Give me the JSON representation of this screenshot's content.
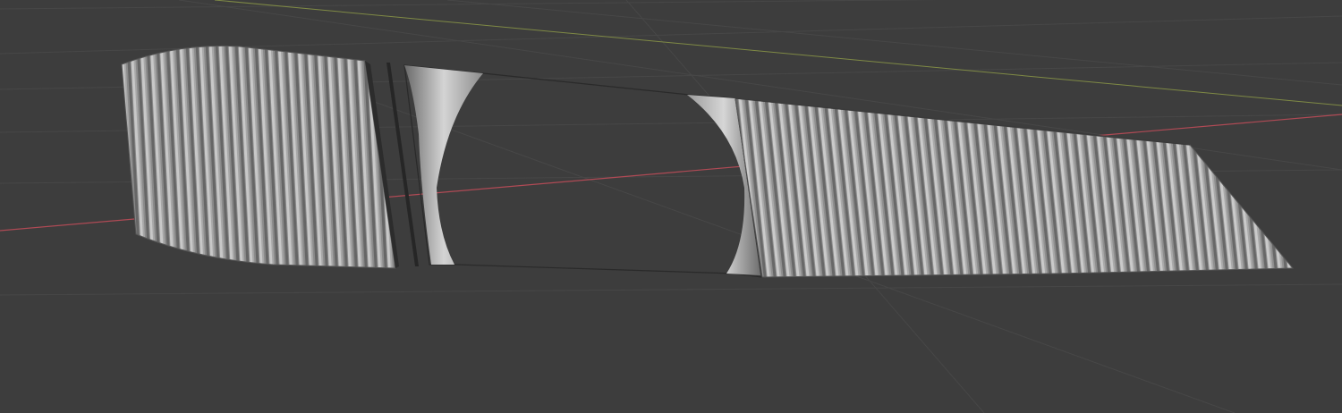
{
  "viewport": {
    "background": "#3d3d3d",
    "grid_color": "#474747",
    "x_axis_color": "#b04a55",
    "y_axis_color": "#7f8a45",
    "mesh_color": "#a9a9a9",
    "mesh_edge_color": "#2b2b2b"
  },
  "objects": [
    {
      "name": "left-panel",
      "kind": "corrugated-mesh"
    },
    {
      "name": "spine-strip",
      "kind": "mesh-edge"
    },
    {
      "name": "cutout-panel",
      "kind": "mesh-with-circular-hole"
    },
    {
      "name": "right-panel",
      "kind": "corrugated-mesh"
    }
  ]
}
